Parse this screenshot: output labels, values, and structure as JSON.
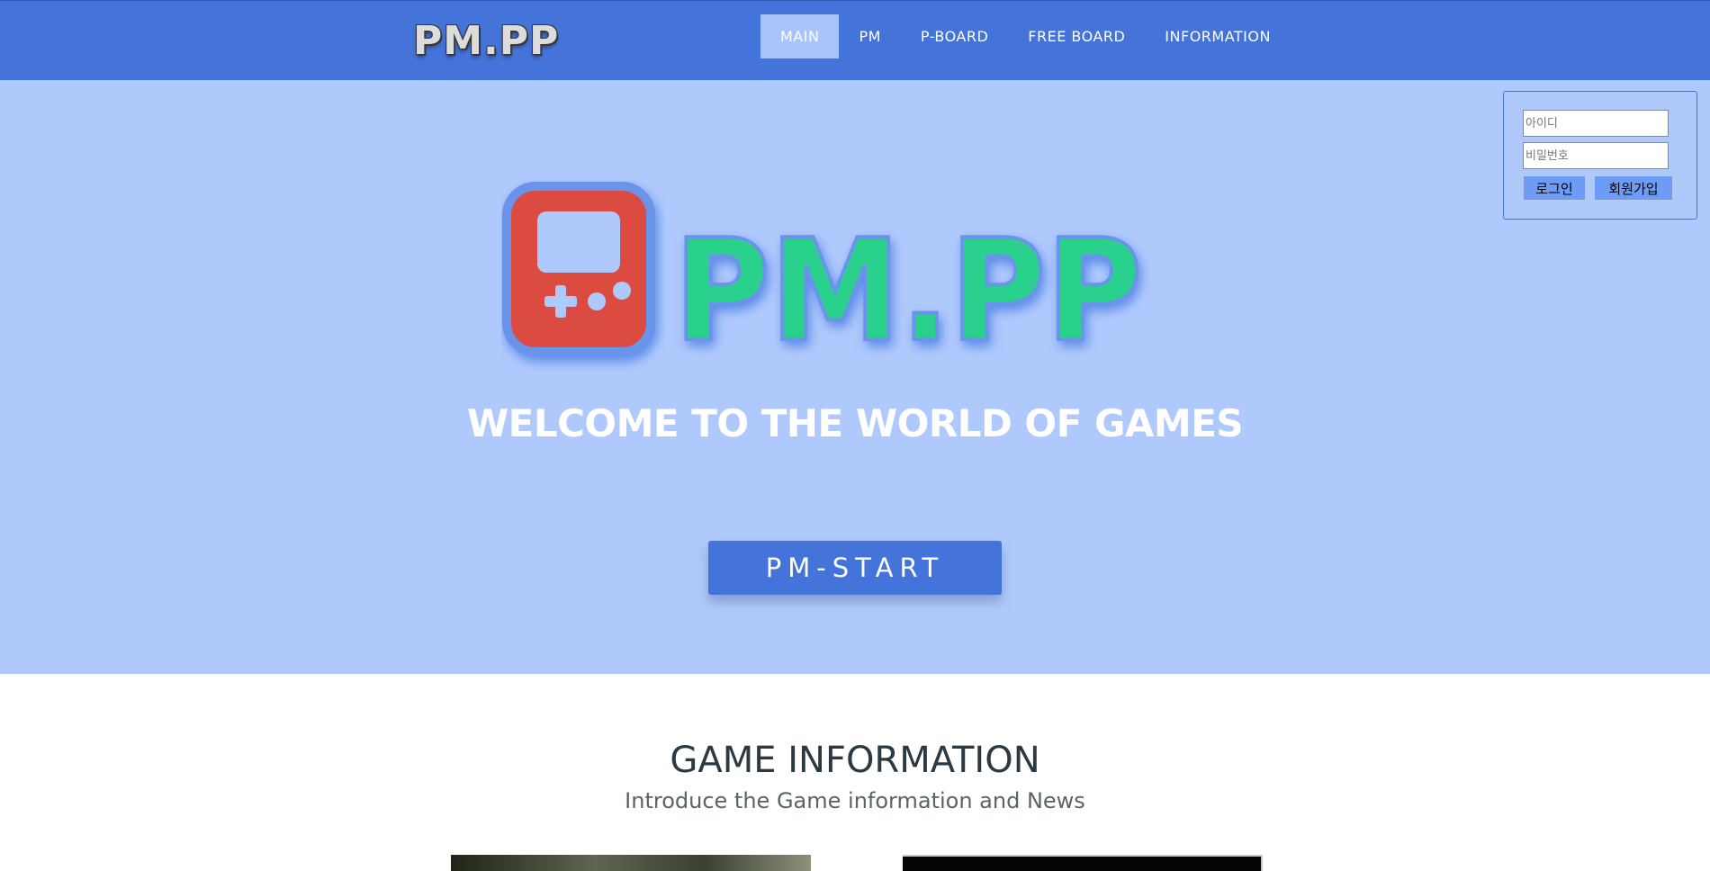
{
  "colors": {
    "navbar": "#4473da",
    "nav_active": "#a9c4fb",
    "hero_background": "#b0c9fc",
    "button": "#4473da",
    "logo_red": "#db4b3f",
    "logo_green": "#2ad18d",
    "logo_glow": "#5a8be8"
  },
  "navbar": {
    "brand": "PM.PP",
    "items": [
      {
        "label": "MAIN",
        "active": true
      },
      {
        "label": "PM",
        "active": false
      },
      {
        "label": "P-BOARD",
        "active": false
      },
      {
        "label": "FREE BOARD",
        "active": false
      },
      {
        "label": "INFORMATION",
        "active": false
      }
    ]
  },
  "hero": {
    "logo_text": "PM.PP",
    "logo_icon": "gameboy-icon",
    "welcome": "WELCOME TO THE WORLD OF GAMES",
    "start_button": "PM-START"
  },
  "login": {
    "id_placeholder": "아이디",
    "password_placeholder": "비밀번호",
    "login_button": "로그인",
    "signup_button": "회원가입"
  },
  "game_info": {
    "title": "GAME INFORMATION",
    "subtitle": "Introduce the Game information and News"
  }
}
